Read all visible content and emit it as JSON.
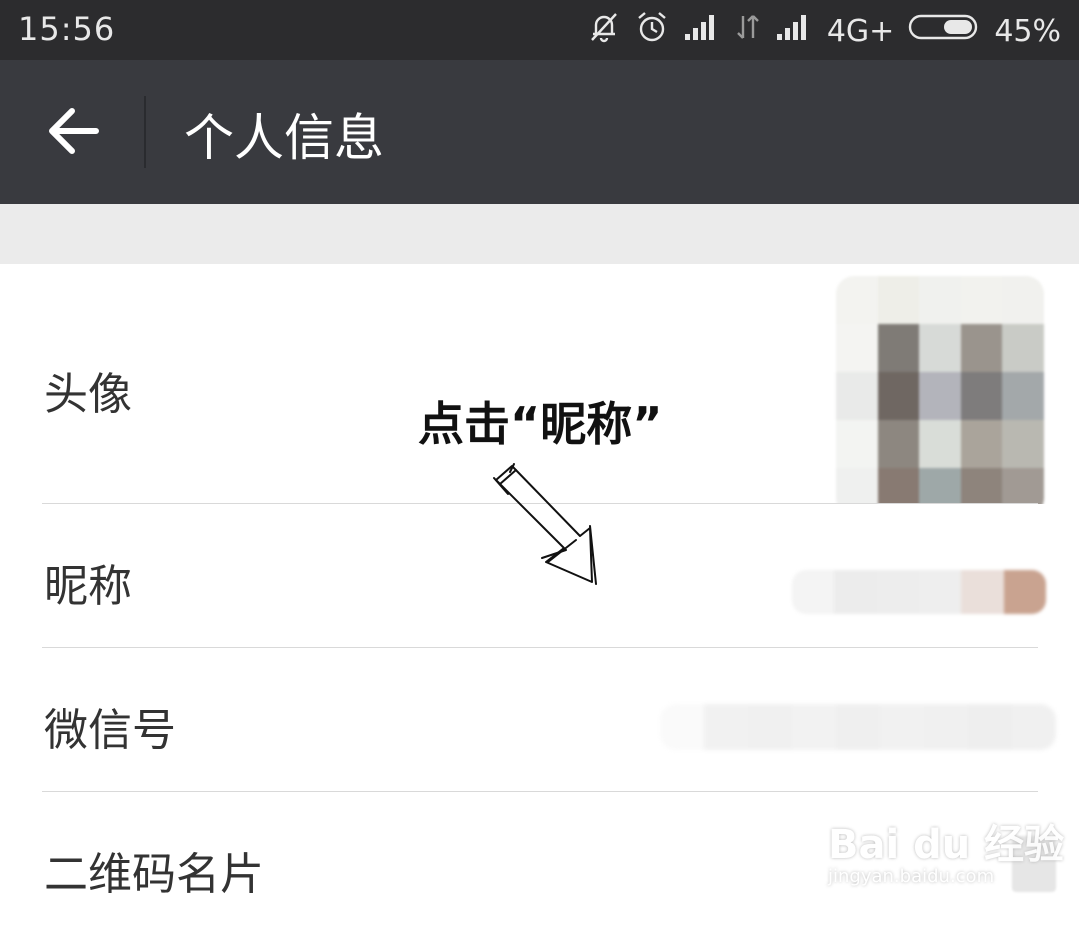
{
  "status_bar": {
    "time": "15:56",
    "network": "4G+",
    "battery": "45%",
    "icons": [
      "notification-muted-icon",
      "alarm-icon",
      "signal-icon",
      "data-transfer-icon",
      "signal-icon",
      "battery-icon"
    ]
  },
  "header": {
    "title": "个人信息",
    "back_icon": "arrow-left-icon"
  },
  "profile_rows": [
    {
      "label": "头像"
    },
    {
      "label": "昵称"
    },
    {
      "label": "微信号"
    },
    {
      "label": "二维码名片"
    }
  ],
  "annotation": {
    "text": "点击“昵称”"
  },
  "watermark": {
    "logo": "Bai du 经验",
    "url": "jingyan.baidu.com"
  },
  "colors": {
    "status_bar": "#2c2c2e",
    "app_bar": "#393a3f",
    "section_gap": "#ebebeb",
    "row_text": "#333333"
  }
}
